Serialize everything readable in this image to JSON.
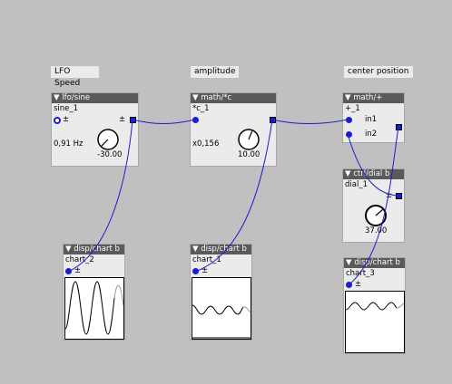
{
  "colors": {
    "canvas": "#c0c0c0",
    "object_body": "#ebebeb",
    "object_header": "#5a5a5a",
    "wire": "#1c1cd0",
    "trace": "#000000"
  },
  "labels": {
    "lfo_speed": "LFO Speed",
    "amplitude": "amplitude",
    "center_position": "center position"
  },
  "lfo": {
    "type": "▼ lfo/sine",
    "instance": "sine_1",
    "pm": "±",
    "freq": "0,91 Hz",
    "knob_value": "-30.00",
    "knob_level": 0.0
  },
  "mul": {
    "type": "▼ math/*c",
    "instance": "*c_1",
    "factor": "x0,156",
    "knob_value": "10.00",
    "knob_level": 0.58
  },
  "add": {
    "type": "▼ math/+",
    "instance": "+_1",
    "in1": "in1",
    "in2": "in2"
  },
  "dial": {
    "type": "▼ ctrl/dial b",
    "instance": "dial_1",
    "pm": "±",
    "value": "37.00",
    "level": 0.68
  },
  "charts": [
    {
      "type": "▼ disp/chart b",
      "instance": "chart_2",
      "pm": "±"
    },
    {
      "type": "▼ disp/chart b",
      "instance": "chart_1",
      "pm": "±"
    },
    {
      "type": "▼ disp/chart b",
      "instance": "chart_3",
      "pm": "±"
    }
  ]
}
